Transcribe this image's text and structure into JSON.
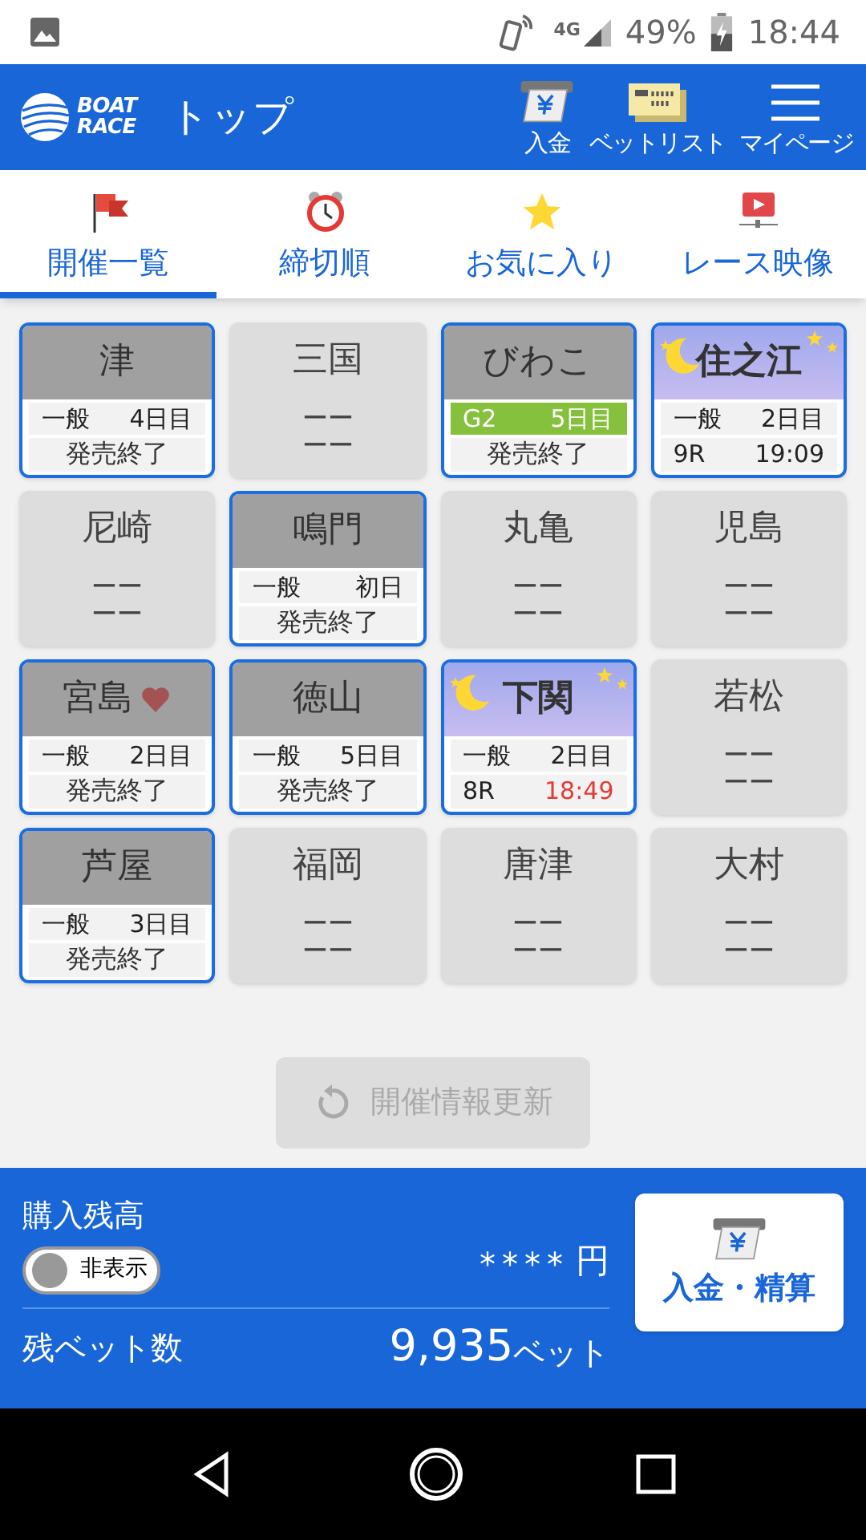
{
  "status_bar": {
    "battery": "49%",
    "time": "18:44",
    "network": "4G"
  },
  "header": {
    "logo_lines": [
      "BOAT",
      "RACE"
    ],
    "title": "トップ",
    "actions": [
      {
        "kind": "deposit",
        "label": "入金"
      },
      {
        "kind": "betlist",
        "label": "ベットリスト"
      },
      {
        "kind": "menu",
        "label": "マイページ"
      }
    ]
  },
  "tabs": [
    {
      "kind": "flag",
      "label": "開催一覧",
      "selected": true
    },
    {
      "kind": "clock",
      "label": "締切順",
      "selected": false
    },
    {
      "kind": "star",
      "label": "お気に入り",
      "selected": false
    },
    {
      "kind": "video",
      "label": "レース映像",
      "selected": false
    }
  ],
  "venues": [
    {
      "name": "津",
      "kind": "open",
      "night": false,
      "favorite": false,
      "grade": "一般",
      "day": "4日目",
      "status": "発売終了"
    },
    {
      "name": "三国",
      "kind": "idle",
      "lines": [
        "ーー",
        "ーー"
      ]
    },
    {
      "name": "びわこ",
      "kind": "open",
      "night": false,
      "favorite": false,
      "grade": "G2",
      "day": "5日目",
      "color": "#86c13d",
      "status": "発売終了"
    },
    {
      "name": "住之江",
      "kind": "open",
      "night": true,
      "favorite": false,
      "grade": "一般",
      "day": "2日目",
      "race": "9R",
      "time": "19:09",
      "urgent": false
    },
    {
      "name": "尼崎",
      "kind": "idle",
      "lines": [
        "ーー",
        "ーー"
      ]
    },
    {
      "name": "鳴門",
      "kind": "open",
      "night": false,
      "favorite": false,
      "grade": "一般",
      "day": "初日",
      "status": "発売終了"
    },
    {
      "name": "丸亀",
      "kind": "idle",
      "lines": [
        "ーー",
        "ーー"
      ]
    },
    {
      "name": "児島",
      "kind": "idle",
      "lines": [
        "ーー",
        "ーー"
      ]
    },
    {
      "name": "宮島",
      "kind": "open",
      "night": false,
      "favorite": true,
      "grade": "一般",
      "day": "2日目",
      "status": "発売終了"
    },
    {
      "name": "徳山",
      "kind": "open",
      "night": false,
      "favorite": false,
      "grade": "一般",
      "day": "5日目",
      "status": "発売終了"
    },
    {
      "name": "下関",
      "kind": "open",
      "night": true,
      "favorite": false,
      "grade": "一般",
      "day": "2日目",
      "race": "8R",
      "time": "18:49",
      "urgent": true
    },
    {
      "name": "若松",
      "kind": "idle",
      "lines": [
        "ーー",
        "ーー"
      ]
    },
    {
      "name": "芦屋",
      "kind": "open",
      "night": false,
      "favorite": false,
      "grade": "一般",
      "day": "3日目",
      "status": "発売終了"
    },
    {
      "name": "福岡",
      "kind": "idle",
      "lines": [
        "ーー",
        "ーー"
      ]
    },
    {
      "name": "唐津",
      "kind": "idle",
      "lines": [
        "ーー",
        "ーー"
      ]
    },
    {
      "name": "大村",
      "kind": "idle",
      "lines": [
        "ーー",
        "ーー"
      ]
    }
  ],
  "refresh_button": {
    "label": "開催情報更新",
    "disabled": true
  },
  "footer": {
    "balance_label": "購入残高",
    "toggle": {
      "label": "非表示",
      "on": false
    },
    "balance_value": "****",
    "balance_unit": "円",
    "bets_label": "残ベット数",
    "bets_value": "9,935",
    "bets_unit": "ベット",
    "deposit_button": "入金・精算"
  }
}
